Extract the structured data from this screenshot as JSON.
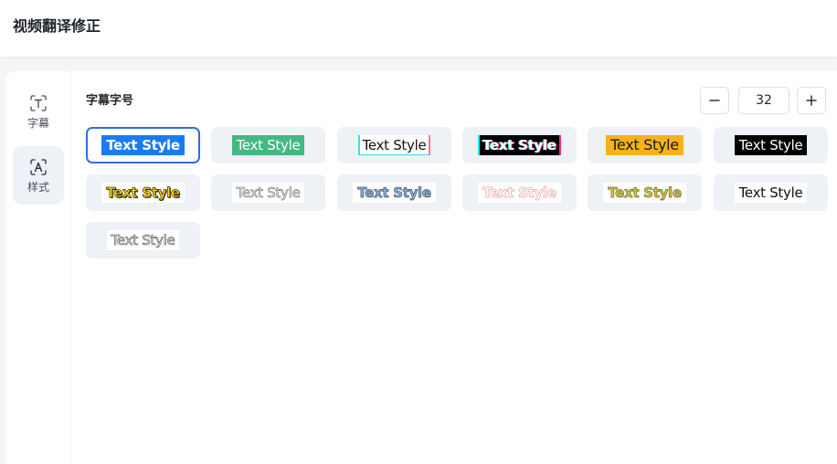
{
  "app": {
    "title": "视频翻译修正"
  },
  "sidebar": {
    "items": [
      {
        "label": "字幕",
        "icon": "text-icon"
      },
      {
        "label": "样式",
        "icon": "font-style-icon"
      }
    ]
  },
  "panel": {
    "section_title": "字幕字号",
    "font_size": {
      "value": "32",
      "minus_icon": "minus-icon",
      "plus_icon": "plus-icon"
    },
    "styles": [
      {
        "label": "Text Style",
        "selected": true
      },
      {
        "label": "Text Style"
      },
      {
        "label": "Text Style"
      },
      {
        "label": "Text Style"
      },
      {
        "label": "Text Style"
      },
      {
        "label": "Text Style"
      },
      {
        "label": "Text Style"
      },
      {
        "label": "Text Style"
      },
      {
        "label": "Text Style"
      },
      {
        "label": "Text Style"
      },
      {
        "label": "Text Style"
      },
      {
        "label": "Text Style"
      },
      {
        "label": "Text Style"
      }
    ]
  },
  "colors": {
    "accent": "#2f6fde",
    "card_bg": "#eef1f6",
    "page_bg": "#f4f5f7"
  }
}
